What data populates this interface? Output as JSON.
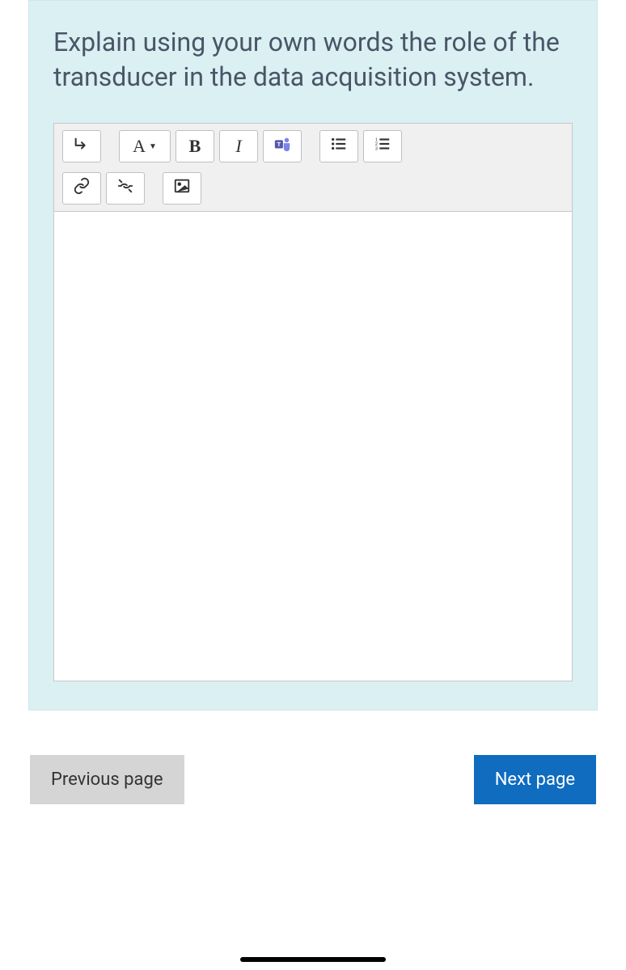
{
  "question": {
    "text": "Explain using your own words the role of the transducer in the data acquisition system."
  },
  "toolbar": {
    "toggle_label": "↴",
    "font_label": "A",
    "bold_label": "B",
    "italic_label": "I"
  },
  "editor": {
    "content": ""
  },
  "nav": {
    "prev_label": "Previous page",
    "next_label": "Next page"
  }
}
